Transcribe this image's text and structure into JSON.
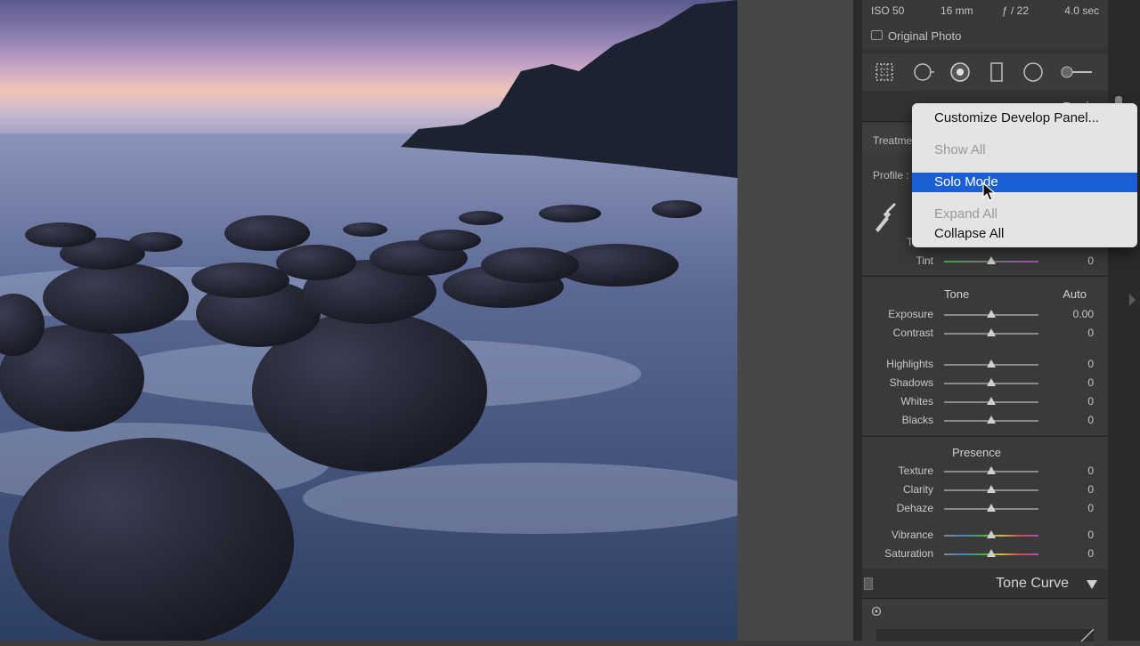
{
  "exif": {
    "iso": "ISO 50",
    "focal": "16 mm",
    "aperture": "ƒ / 22",
    "shutter": "4.0 sec",
    "original_photo": "Original Photo"
  },
  "basic": {
    "treatment_label": "Treatme",
    "profile_label": "Profile :",
    "basic_partial": "Basic"
  },
  "menu": {
    "items": [
      {
        "label": "Customize Develop Panel...",
        "state": "enabled"
      },
      {
        "label": "Show All",
        "state": "disabled"
      },
      {
        "label": "Solo Mode",
        "state": "selected"
      },
      {
        "label": "Expand All",
        "state": "disabled"
      },
      {
        "label": "Collapse All",
        "state": "enabled"
      }
    ]
  },
  "sliders": {
    "tint": {
      "label": "Tint",
      "value": "0"
    },
    "tone_header": "Tone",
    "auto": "Auto",
    "exposure": {
      "label": "Exposure",
      "value": "0.00"
    },
    "contrast": {
      "label": "Contrast",
      "value": "0"
    },
    "highlights": {
      "label": "Highlights",
      "value": "0"
    },
    "shadows": {
      "label": "Shadows",
      "value": "0"
    },
    "whites": {
      "label": "Whites",
      "value": "0"
    },
    "blacks": {
      "label": "Blacks",
      "value": "0"
    },
    "presence_header": "Presence",
    "texture": {
      "label": "Texture",
      "value": "0"
    },
    "clarity": {
      "label": "Clarity",
      "value": "0"
    },
    "dehaze": {
      "label": "Dehaze",
      "value": "0"
    },
    "vibrance": {
      "label": "Vibrance",
      "value": "0"
    },
    "saturation": {
      "label": "Saturation",
      "value": "0"
    }
  },
  "tone_curve": {
    "label": "Tone Curve"
  },
  "colors": {
    "menu_highlight": "#1a5fd6",
    "panel_bg": "#3a3a3a"
  },
  "icons": [
    "crop-overlay-icon",
    "spot-removal-icon",
    "red-eye-icon",
    "graduated-filter-icon",
    "radial-filter-icon",
    "adjustment-brush-icon",
    "eyedropper-icon",
    "target-adjust-icon"
  ]
}
